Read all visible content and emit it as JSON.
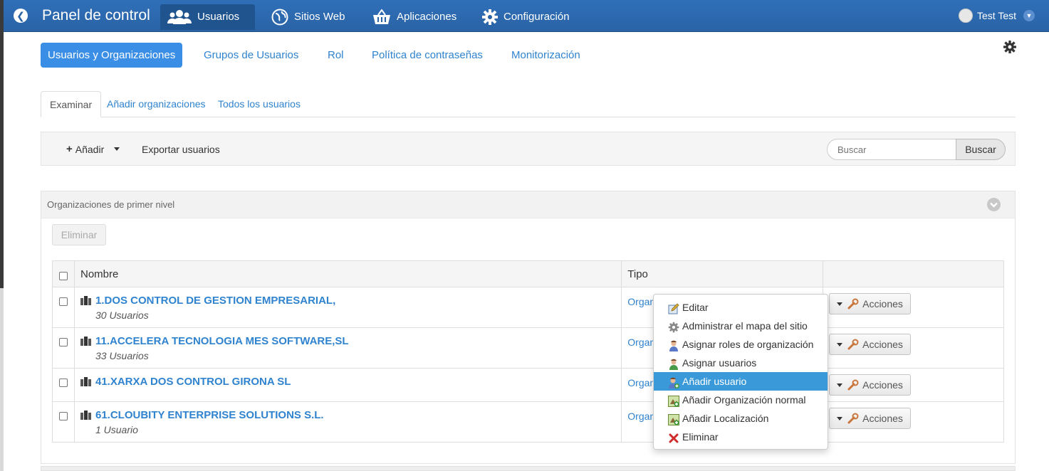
{
  "topbar": {
    "brand": "Panel de control",
    "nav": [
      {
        "label": "Usuarios",
        "icon": "users-icon",
        "active": true
      },
      {
        "label": "Sitios Web",
        "icon": "globe-icon"
      },
      {
        "label": "Aplicaciones",
        "icon": "basket-icon"
      },
      {
        "label": "Configuración",
        "icon": "gear-icon"
      }
    ],
    "user": "Test Test"
  },
  "subnav": [
    "Usuarios y Organizaciones",
    "Grupos de Usuarios",
    "Rol",
    "Política de contraseñas",
    "Monitorización"
  ],
  "tabs": [
    "Examinar",
    "Añadir organizaciones",
    "Todos los usuarios"
  ],
  "toolbar": {
    "add_label": "Añadir",
    "export_label": "Exportar usuarios",
    "search_placeholder": "Buscar",
    "search_button": "Buscar"
  },
  "panel": {
    "title": "Organizaciones de primer nivel",
    "delete_label": "Eliminar"
  },
  "table": {
    "headers": [
      "Nombre",
      "Tipo",
      ""
    ],
    "rows": [
      {
        "name": "1.DOS CONTROL DE GESTION EMPRESARIAL,",
        "users": "30 Usuarios",
        "type": "Organización normal",
        "actions": "Acciones"
      },
      {
        "name": "11.ACCELERA TECNOLOGIA MES SOFTWARE,SL",
        "users": "33 Usuarios",
        "type": "Organización normal",
        "actions": "Acciones"
      },
      {
        "name": "41.XARXA DOS CONTROL GIRONA SL",
        "users": "",
        "type": "Organización normal",
        "actions": "Acciones"
      },
      {
        "name": "61.CLOUBITY ENTERPRISE SOLUTIONS S.L.",
        "users": "1 Usuario",
        "type": "Organización normal",
        "actions": "Acciones"
      }
    ]
  },
  "dropdown": {
    "items": [
      {
        "label": "Editar",
        "icon": "edit-icon"
      },
      {
        "label": "Administrar el mapa del sitio",
        "icon": "gear-small-icon"
      },
      {
        "label": "Asignar roles de organización",
        "icon": "user-role-icon"
      },
      {
        "label": "Asignar usuarios",
        "icon": "user-assign-icon"
      },
      {
        "label": "Añadir usuario",
        "icon": "user-add-icon",
        "active": true
      },
      {
        "label": "Añadir Organización normal",
        "icon": "org-add-icon"
      },
      {
        "label": "Añadir Localización",
        "icon": "location-add-icon"
      },
      {
        "label": "Eliminar",
        "icon": "delete-x-icon"
      }
    ]
  }
}
